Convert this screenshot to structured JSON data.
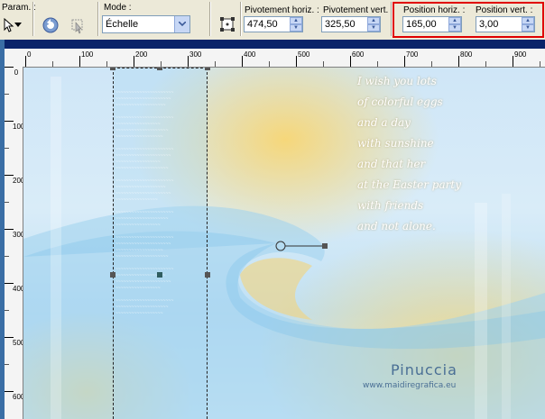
{
  "toolbar": {
    "param_label": "Param. :",
    "mode_label": "Mode :",
    "mode_value": "Échelle",
    "pivot_h_label": "Pivotement horiz. :",
    "pivot_h_value": "474,50",
    "pivot_v_label": "Pivotement vert. :",
    "pivot_v_value": "325,50",
    "pos_h_label": "Position horiz. :",
    "pos_h_value": "165,00",
    "pos_v_label": "Position vert. :",
    "pos_v_value": "3,00",
    "highlight_color": "#e00000"
  },
  "ruler": {
    "h_ticks": [
      "0",
      "100",
      "200",
      "300",
      "400",
      "500",
      "600",
      "700",
      "800",
      "900"
    ],
    "v_ticks": [
      "0",
      "100",
      "200",
      "300",
      "400",
      "500",
      "600"
    ]
  },
  "canvas": {
    "poem": [
      "I wish you lots",
      "of colorful eggs",
      "and a day",
      "with sunshine",
      "and that her",
      "at the Easter party",
      "with friends",
      "and not alone."
    ],
    "watermark_name": "Pinuccia",
    "watermark_url": "www.maidiregrafica.eu"
  }
}
